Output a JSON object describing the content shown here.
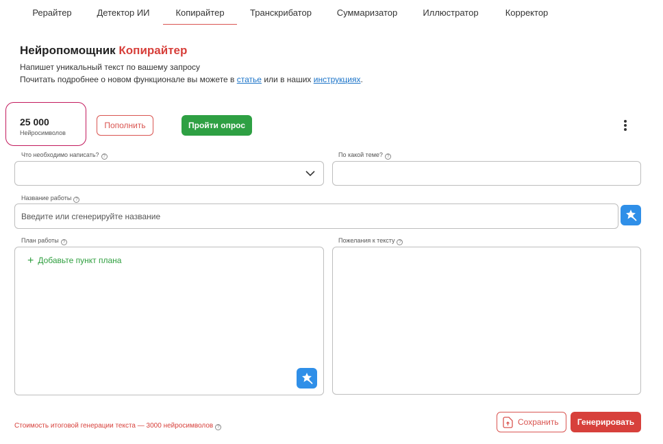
{
  "tabs": [
    {
      "label": "Рерайтер"
    },
    {
      "label": "Детектор ИИ"
    },
    {
      "label": "Копирайтер",
      "active": true
    },
    {
      "label": "Транскрибатор"
    },
    {
      "label": "Суммаризатор"
    },
    {
      "label": "Иллюстратор"
    },
    {
      "label": "Корректор"
    }
  ],
  "header": {
    "title_main": "Нейропомощник",
    "title_accent": "Копирайтер",
    "subtitle": "Напишет уникальный текст по вашему запросу",
    "info_prefix": "Почитать подробнее о новом функционале вы можете в",
    "info_link1": "статье",
    "info_middle": "или в наших",
    "info_link2": "инструкциях",
    "info_suffix": "."
  },
  "balance": {
    "amount": "25 000",
    "unit": "Нейросимволов"
  },
  "actions": {
    "topup_label": "Пополнить",
    "survey_label": "Пройти опрос"
  },
  "form": {
    "what_label": "Что необходимо написать?",
    "what_value": "",
    "topic_label": "По какой теме?",
    "topic_value": "",
    "name_label": "Название работы",
    "name_placeholder": "Введите или сгенерируйте название",
    "plan_label": "План работы",
    "add_plan_label": "Добавьте пункт плана",
    "wishes_label": "Пожелания к тексту"
  },
  "footer": {
    "cost_text": "Стоимость итоговой генерации текста — 3000 нейросимволов",
    "save_label": "Сохранить",
    "generate_label": "Генерировать"
  },
  "colors": {
    "accent_red": "#d7403b",
    "green": "#2ea043",
    "blue": "#2f8fe8",
    "balance_border": "#c2185b"
  }
}
